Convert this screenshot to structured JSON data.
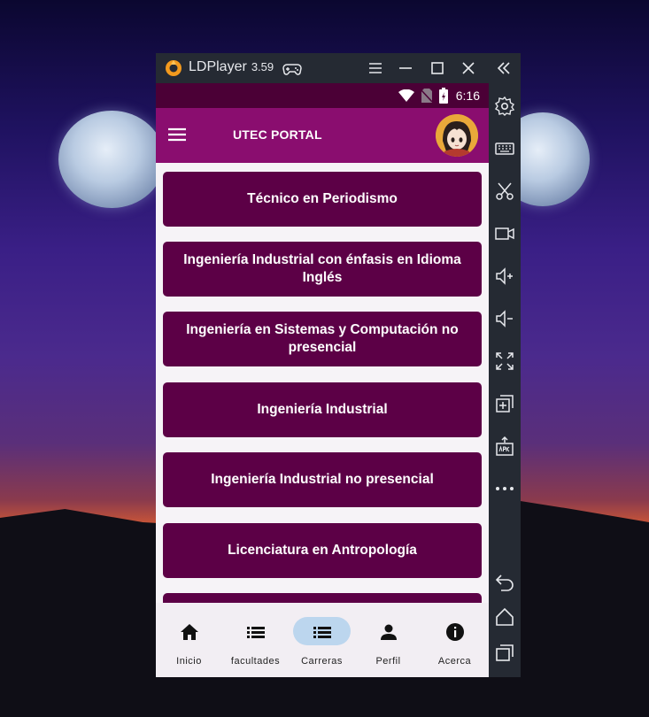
{
  "window": {
    "app_name": "LDPlayer",
    "version": "3.59"
  },
  "statusbar": {
    "time": "6:16"
  },
  "appbar": {
    "title": "UTEC PORTAL"
  },
  "careers": [
    {
      "label": "Técnico en Periodismo"
    },
    {
      "label": "Ingeniería Industrial con énfasis en Idioma Inglés"
    },
    {
      "label": "Ingeniería en Sistemas y Computación no presencial"
    },
    {
      "label": "Ingeniería Industrial"
    },
    {
      "label": "Ingeniería Industrial no presencial"
    },
    {
      "label": "Licenciatura en Antropología"
    },
    {
      "label": ""
    }
  ],
  "bottom_nav": {
    "items": [
      {
        "label": "Inicio",
        "icon": "home-icon"
      },
      {
        "label": "facultades",
        "icon": "list-icon"
      },
      {
        "label": "Carreras",
        "icon": "list-icon",
        "active": true
      },
      {
        "label": "Perfil",
        "icon": "person-icon"
      },
      {
        "label": "Acerca",
        "icon": "info-icon"
      }
    ]
  },
  "sidebar_tools": [
    "settings-icon",
    "keyboard-icon",
    "scissors-icon",
    "video-icon",
    "volume-up-icon",
    "volume-down-icon",
    "fullscreen-icon",
    "multi-instance-icon",
    "apk-install-icon",
    "more-icon",
    "back-icon",
    "home-icon",
    "recent-apps-icon"
  ],
  "colors": {
    "appbar": "#8a0d6f",
    "statusbar": "#4b0036",
    "button": "#5c0046",
    "nav_active": "#bcd6ee",
    "emulator_chrome": "#252a33"
  }
}
